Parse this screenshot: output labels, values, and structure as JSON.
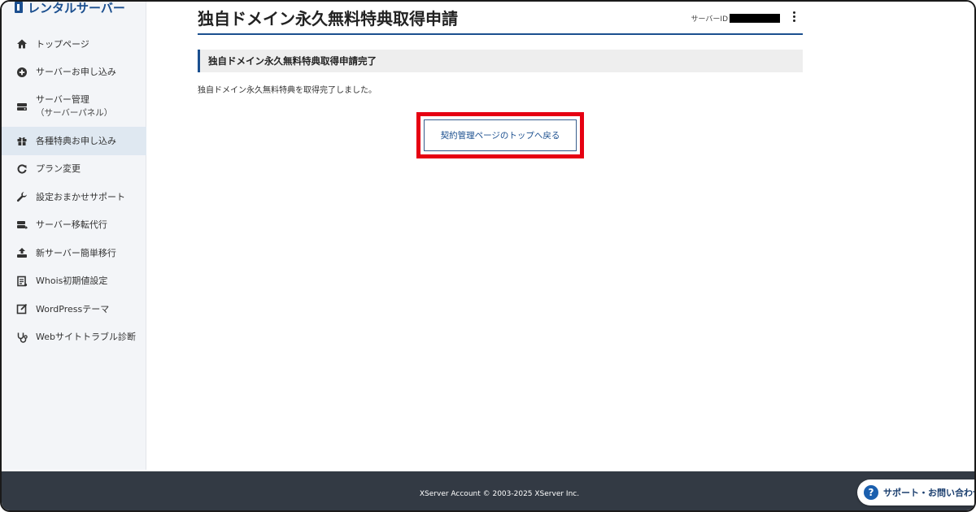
{
  "brand": {
    "name": "レンタルサーバー"
  },
  "sidebar": {
    "items": [
      {
        "label": "トップページ",
        "icon": "home-icon"
      },
      {
        "label": "サーバーお申し込み",
        "icon": "plus-circle-icon"
      },
      {
        "label": "サーバー管理",
        "sub": "（サーバーパネル）",
        "icon": "server-icon"
      },
      {
        "label": "各種特典お申し込み",
        "icon": "gift-icon",
        "active": true
      },
      {
        "label": "プラン変更",
        "icon": "refresh-icon"
      },
      {
        "label": "設定おまかせサポート",
        "icon": "wrench-icon"
      },
      {
        "label": "サーバー移転代行",
        "icon": "server-transfer-icon"
      },
      {
        "label": "新サーバー簡単移行",
        "icon": "upload-icon"
      },
      {
        "label": "Whois初期値設定",
        "icon": "document-icon"
      },
      {
        "label": "WordPressテーマ",
        "icon": "edit-icon"
      },
      {
        "label": "Webサイトトラブル診断",
        "icon": "stethoscope-icon"
      }
    ]
  },
  "header": {
    "title": "独自ドメイン永久無料特典取得申請",
    "server_id_label": "サーバーID"
  },
  "main": {
    "section_title": "独自ドメイン永久無料特典取得申請完了",
    "message": "独自ドメイン永久無料特典を取得完了しました。",
    "back_button": "契約管理ページのトップへ戻る"
  },
  "footer": {
    "copyright": "XServer Account © 2003-2025 XServer Inc.",
    "support_label": "サポート・お問い合わせ"
  },
  "colors": {
    "accent": "#1b4f8f",
    "highlight": "#e60012",
    "footer": "#333a44",
    "sidebar_active": "#dfe8f1"
  }
}
